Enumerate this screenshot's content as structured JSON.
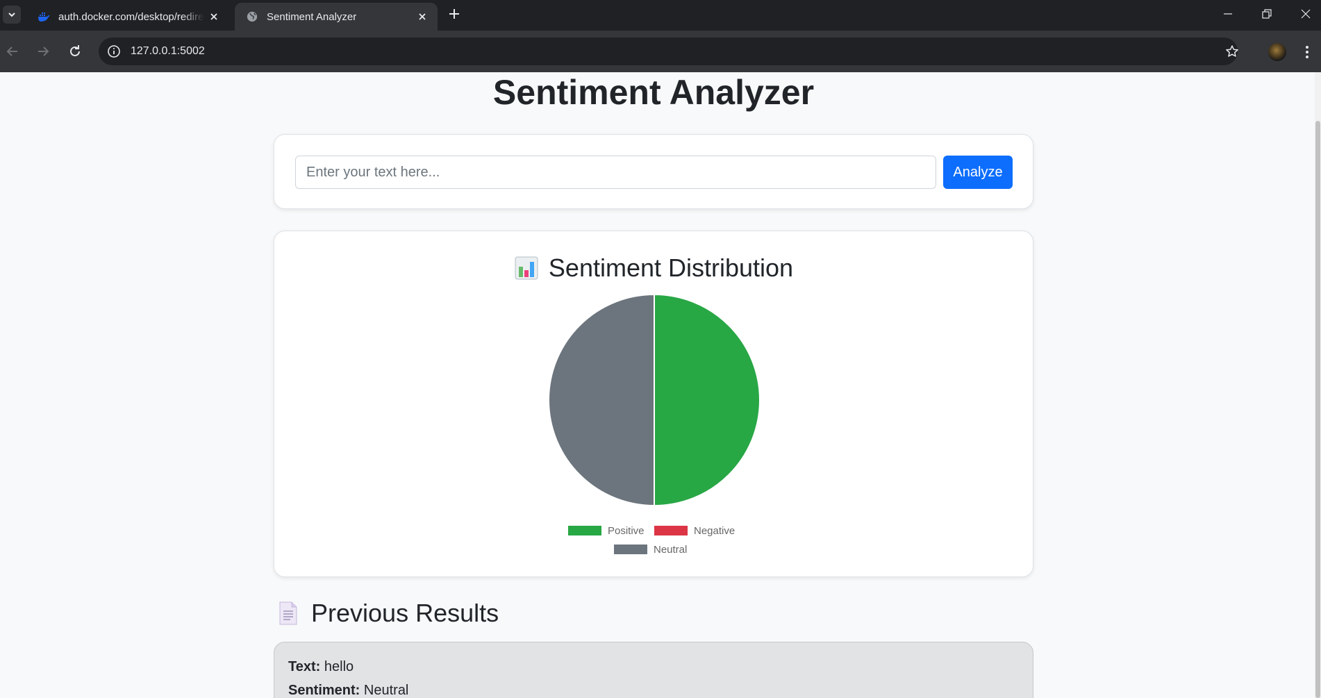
{
  "browser": {
    "tabs": [
      {
        "title": "auth.docker.com/desktop/redirect",
        "icon": "docker-icon",
        "active": false
      },
      {
        "title": "Sentiment Analyzer",
        "icon": "globe-icon",
        "active": true
      }
    ],
    "url": "127.0.0.1:5002"
  },
  "page": {
    "title": "Sentiment Analyzer",
    "input": {
      "placeholder": "Enter your text here...",
      "value": ""
    },
    "analyze_label": "Analyze",
    "chart_section": {
      "emoji": "📊",
      "heading": "Sentiment Distribution"
    },
    "results_section": {
      "emoji": "📄",
      "heading": "Previous Results",
      "items": [
        {
          "text_label": "Text:",
          "text": "hello",
          "sentiment_label": "Sentiment:",
          "sentiment": "Neutral"
        }
      ]
    }
  },
  "colors": {
    "positive": "#28a745",
    "negative": "#dc3545",
    "neutral": "#6c757d",
    "primary": "#0d6efd"
  },
  "chart_data": {
    "type": "pie",
    "categories": [
      "Positive",
      "Negative",
      "Neutral"
    ],
    "values": [
      1,
      0,
      1
    ],
    "colors": [
      "#28a745",
      "#dc3545",
      "#6c757d"
    ],
    "legend_position": "bottom"
  }
}
